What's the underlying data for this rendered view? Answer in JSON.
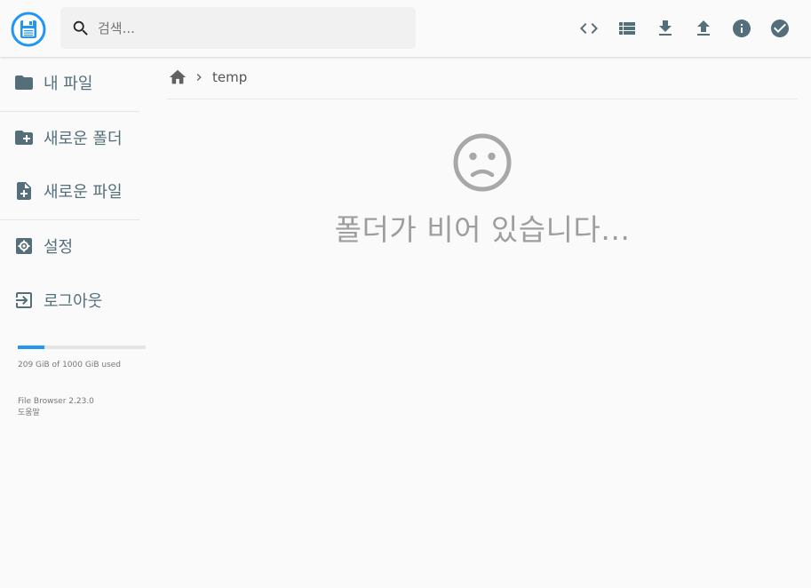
{
  "header": {
    "search_placeholder": "검색...",
    "actions": [
      "code-view",
      "list-view",
      "download",
      "upload",
      "info",
      "select"
    ]
  },
  "sidebar": {
    "items": [
      {
        "label": "내 파일",
        "icon": "folder-icon"
      },
      {
        "label": "새로운 폴더",
        "icon": "create-new-folder-icon"
      },
      {
        "label": "새로운 파일",
        "icon": "note-add-icon"
      },
      {
        "label": "설정",
        "icon": "settings-icon"
      },
      {
        "label": "로그아웃",
        "icon": "exit-icon"
      }
    ],
    "usage": {
      "text": "209 GiB of 1000 GiB used",
      "fraction": 0.209
    },
    "credits": {
      "version": "File Browser 2.23.0",
      "help": "도움말"
    }
  },
  "breadcrumbs": {
    "path": [
      "temp"
    ]
  },
  "main": {
    "empty_message": "폴더가 비어 있습니다..."
  },
  "colors": {
    "accent": "#2196f3",
    "icon": "#546e7a",
    "muted_text": "#9e9e9e",
    "background": "#fafafa"
  }
}
